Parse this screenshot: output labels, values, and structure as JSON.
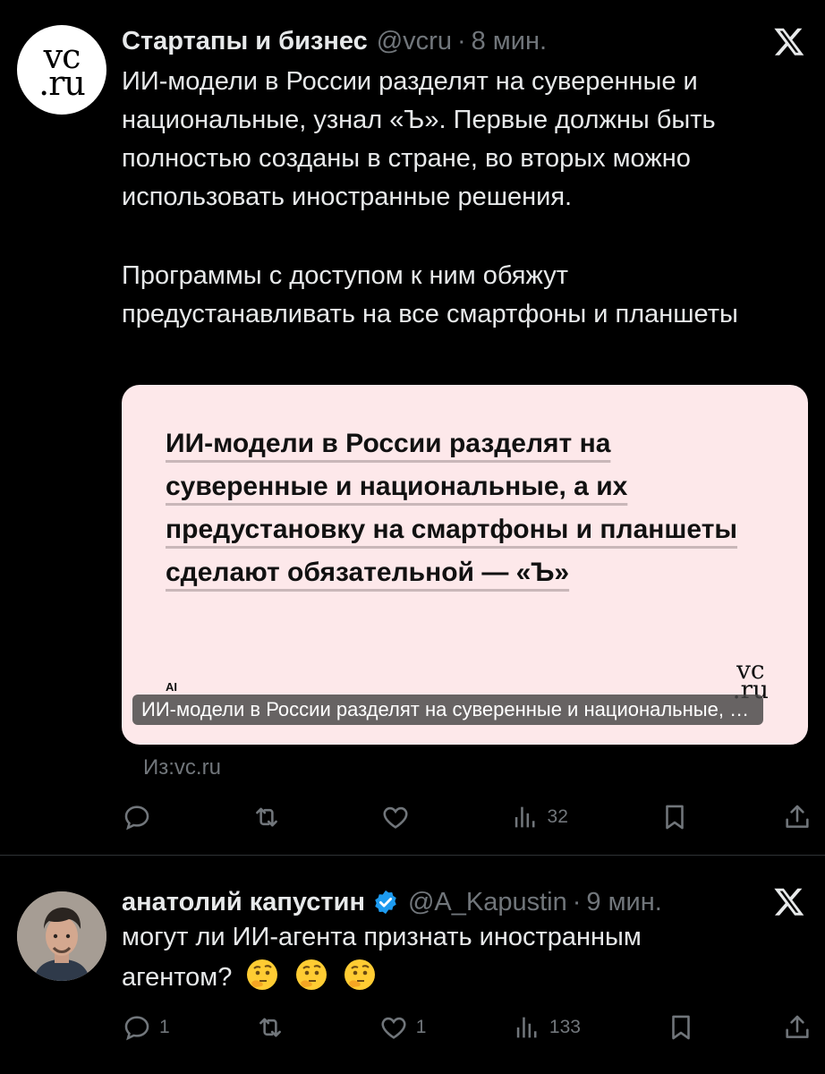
{
  "tweet1": {
    "avatar_logo_lines": [
      "vc",
      ".ru"
    ],
    "name": "Стартапы и бизнес",
    "handle": "@vcru",
    "separator": "·",
    "time": "8 мин.",
    "text_paragraph1": "ИИ-модели в России разделят на суверенные и национальные, узнал «Ъ». Первые должны быть полностью созданы в стране, во вторых можно использовать иностранные решения.",
    "text_paragraph2": "Программы с доступом к ним обяжут предустанавливать на все смартфоны и планшеты",
    "card": {
      "headline": "ИИ-модели в России разделят на суверенные и национальные, а их предустановку на смартфоны и планшеты сделают обязательной — «Ъ»",
      "tag": "AI",
      "logo_lines": [
        "vc",
        ".ru"
      ],
      "caption": "ИИ-модели в России разделят на суверенные и национальные, а их предустановку на смартфоны и планшеты сделают обязательной — «Ъ»"
    },
    "source": "Из:vc.ru",
    "actions": {
      "reply_count": "",
      "repost_count": "",
      "like_count": "",
      "views_count": "32"
    }
  },
  "tweet2": {
    "name": "анатолий капустин",
    "handle": "@A_Kapustin",
    "separator": "·",
    "time": "9 мин.",
    "text": "могут ли ИИ-агента признать иностранным агентом?",
    "emoji_icons": [
      "thinking-face-icon",
      "thinking-face-icon",
      "thinking-face-icon"
    ],
    "actions": {
      "reply_count": "1",
      "repost_count": "",
      "like_count": "1",
      "views_count": "133"
    }
  },
  "colors": {
    "background": "#000000",
    "text": "#e7e9ea",
    "muted": "#71767b",
    "verified": "#1d9bf0",
    "card_bg": "#fde8ea"
  }
}
